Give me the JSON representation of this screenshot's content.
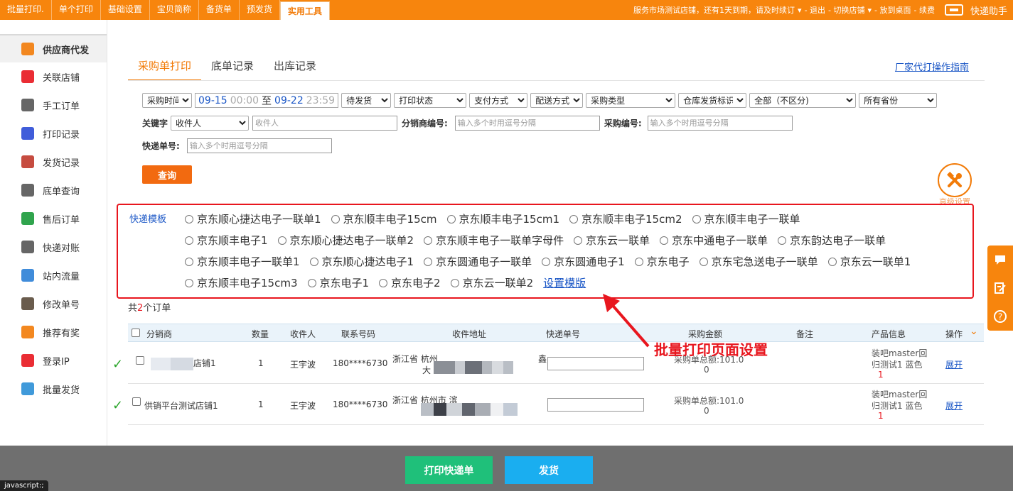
{
  "topnav": {
    "items": [
      "批量打印.",
      "单个打印",
      "基础设置",
      "宝贝简称",
      "备货单",
      "预发货",
      "实用工具"
    ],
    "active_index": 6,
    "right": {
      "notice": "服务市场测试店铺，还有1天到期，请及时续订",
      "logout": "- 退出",
      "switch_shop": "- 切换店铺",
      "desktop": "- 放到桌面",
      "renew": "- 续费",
      "brand": "快递助手"
    }
  },
  "sidebar": {
    "items": [
      {
        "label": "供应商代发",
        "icon": "printer-icon",
        "color": "#f27b08",
        "active": true
      },
      {
        "label": "关联店铺",
        "icon": "dice-icon",
        "color": "#e8161e"
      },
      {
        "label": "手工订单",
        "icon": "printer-icon",
        "color": "#555555"
      },
      {
        "label": "打印记录",
        "icon": "flickr-dots-icon",
        "color": "#2b4bd6"
      },
      {
        "label": "发货记录",
        "icon": "calendar-icon",
        "color": "#c0392b"
      },
      {
        "label": "底单查询",
        "icon": "barcode-icon",
        "color": "#555555"
      },
      {
        "label": "售后订单",
        "icon": "return-icon",
        "color": "#1a9a3a"
      },
      {
        "label": "快递对账",
        "icon": "receipt-icon",
        "color": "#555555"
      },
      {
        "label": "站内流量",
        "icon": "bar-chart-icon",
        "color": "#2b7fd6"
      },
      {
        "label": "修改单号",
        "icon": "pen-icon",
        "color": "#5a4a3a"
      },
      {
        "label": "推荐有奖",
        "icon": "gift-icon",
        "color": "#f27b08"
      },
      {
        "label": "登录IP",
        "icon": "chrome-icon",
        "color": "#e8161e"
      },
      {
        "label": "批量发货",
        "icon": "box-icon",
        "color": "#2b8fd6"
      }
    ]
  },
  "tabs": [
    "采购单打印",
    "底单记录",
    "出库记录"
  ],
  "guide_link": "厂家代打操作指南",
  "filters": {
    "time_type": "采购时间",
    "date_from": "09-15",
    "time_from": "00:00",
    "to": "至",
    "date_to": "09-22",
    "time_to": "23:59",
    "status": "待发货",
    "print_status": "打印状态",
    "payment": "支付方式",
    "delivery": "配送方式",
    "purchase_type": "采购类型",
    "warehouse_flag": "仓库发货标识",
    "all_type": "全部（不区分)",
    "province": "所有省份"
  },
  "search": {
    "keyword_label": "关键字",
    "keyword_type": "收件人",
    "keyword_placeholder": "收件人",
    "distributor_label": "分销商编号:",
    "distributor_placeholder": "输入多个时用逗号分隔",
    "purchase_label": "采购编号:",
    "purchase_placeholder": "输入多个时用逗号分隔",
    "express_label": "快递单号:",
    "express_placeholder": "输入多个时用逗号分隔",
    "query_button": "查询"
  },
  "advanced_settings": "高级设置",
  "templates": {
    "label": "快递模板",
    "rows": [
      [
        "京东顺心捷达电子一联单1",
        "京东顺丰电子15cm",
        "京东顺丰电子15cm1",
        "京东顺丰电子15cm2",
        "京东顺丰电子一联单"
      ],
      [
        "京东顺丰电子1",
        "京东顺心捷达电子一联单2",
        "京东顺丰电子一联单字母件",
        "京东云一联单",
        "京东中通电子一联单",
        "京东韵达电子一联单"
      ],
      [
        "京东顺丰电子一联单1",
        "京东顺心捷达电子1",
        "京东圆通电子一联单",
        "京东圆通电子1",
        "京东电子",
        "京东宅急送电子一联单",
        "京东云一联单1"
      ],
      [
        "京东顺丰电子15cm3",
        "京东电子1",
        "京东电子2",
        "京东云一联单2"
      ]
    ],
    "set_link": "设置模版"
  },
  "orders": {
    "total_prefix": "共",
    "total_count": "2",
    "total_suffix": "个订单",
    "annotation": "批量打印页面设置",
    "columns": [
      "分销商",
      "数量",
      "收件人",
      "联系号码",
      "收件地址",
      "快递单号",
      "采购金额",
      "备注",
      "产品信息",
      "操作"
    ],
    "rows": [
      {
        "check": "✓",
        "distributor": "店铺1",
        "qty": "1",
        "receiver": "王宇波",
        "phone": "180****6730",
        "addr1": "浙江省 杭州",
        "addr2": "大",
        "addr_extra": "鑫",
        "amount1": "采购单总额:101.0",
        "amount2": "0",
        "product1": "装吧master回",
        "product2": "归测试1 蓝色",
        "product3": "1",
        "action": "展开"
      },
      {
        "check": "✓",
        "distributor": "供销平台测试店铺1",
        "qty": "1",
        "receiver": "王宇波",
        "phone": "180****6730",
        "addr1": "浙江省 杭州市 滨",
        "addr2": "",
        "addr_extra": "",
        "amount1": "采购单总额:101.0",
        "amount2": "0",
        "product1": "装吧master回",
        "product2": "归测试1 蓝色",
        "product3": "1",
        "action": "展开"
      }
    ]
  },
  "bottom": {
    "print_button": "打印快递单",
    "ship_button": "发货"
  },
  "status_bar": "javascript:;",
  "colors": {
    "brand_orange": "#f7850d",
    "link_blue": "#1a56c6",
    "highlight_red": "#e8161e",
    "print_green": "#1fc07a",
    "ship_blue": "#1aaef0"
  }
}
